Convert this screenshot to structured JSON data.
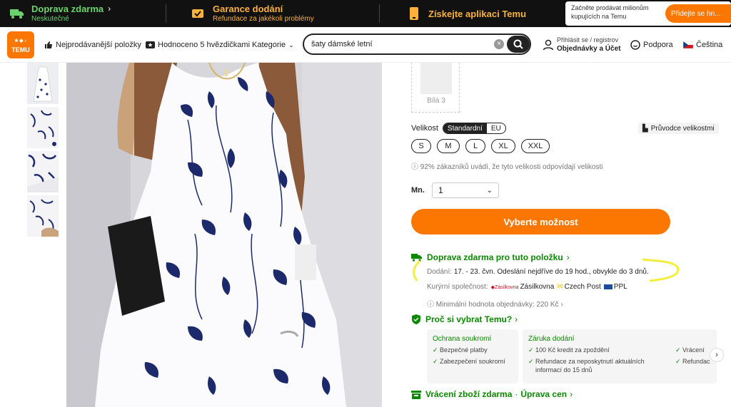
{
  "topbar": {
    "free_shipping": {
      "title": "Doprava zdarma",
      "subtitle": "Neskutečné"
    },
    "delivery": {
      "title": "Garance dodání",
      "subtitle": "Refundace za jakékoli problémy"
    },
    "app": {
      "title": "Získejte aplikaci Temu"
    },
    "seller": {
      "text": "Začněte prodávat milionům kupujících na Temu",
      "button": "Přidejte se hn..."
    }
  },
  "nav": {
    "logo": "TEMU",
    "bestsellers": "Nejprodávanější položky",
    "five_star": "Hodnoceno 5 hvězdičkami",
    "categories": "Kategorie",
    "search_value": "šaty dámské letní",
    "account_line1": "Přihlásit se / registrov",
    "account_line2": "Objednávky a Účet",
    "support": "Podpora",
    "language": "Čeština"
  },
  "product": {
    "swatch_label": "Bílá 3",
    "size_label": "Velikost",
    "size_systems": [
      "Standardní",
      "EU"
    ],
    "size_guide": "Průvodce velikostmi",
    "sizes": [
      "S",
      "M",
      "L",
      "XL",
      "XXL"
    ],
    "fit_note": "92% zákazníků uvádí, že tyto velikosti odpovídají velikosti",
    "qty_label": "Mn.",
    "qty_value": "1",
    "cta": "Vyberte možnost"
  },
  "shipping": {
    "title": "Doprava zdarma pro tuto položku",
    "delivery_label": "Dodání:",
    "delivery_text": "17. - 23. čvn. Odeslání nejdříve do 19 hod., obvykle do 3 dnů.",
    "courier_label": "Kurýrní společnost:",
    "couriers": [
      "Zásilkovna",
      "Czech Post",
      "PPL"
    ],
    "min_order": "Minimální hodnota objednávky: 220 Kč"
  },
  "why": {
    "title": "Proč si vybrat Temu?",
    "privacy": {
      "title": "Ochrana soukromí",
      "items": [
        "Bezpečné platby",
        "Zabezpečení soukromí"
      ]
    },
    "delivery_guarantee": {
      "title": "Záruka dodání",
      "items": [
        "100 Kč kredit za zpoždění",
        "Refundace za neposkytnutí aktuálních informací do 15 dnů"
      ]
    },
    "returns_cut": [
      "Vrácení",
      "Refundac"
    ]
  },
  "returns": {
    "free": "Vrácení zboží zdarma",
    "sep": "·",
    "price": "Úprava cen"
  },
  "colors": {
    "accent": "#fb7701",
    "green": "#0a8800",
    "topbar": "#111111",
    "highlight": "#f3ee3c",
    "print": "#1c2a6b"
  }
}
